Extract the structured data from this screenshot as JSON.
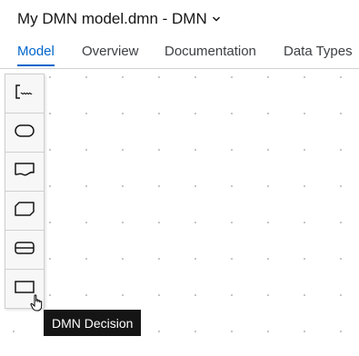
{
  "header": {
    "title": "My DMN model.dmn - DMN",
    "dropdown_icon": "chevron-down-icon"
  },
  "tabs": [
    {
      "label": "Model",
      "active": true
    },
    {
      "label": "Overview",
      "active": false
    },
    {
      "label": "Documentation",
      "active": false
    },
    {
      "label": "Data Types",
      "active": false
    }
  ],
  "palette": {
    "tools": [
      {
        "icon": "text-annotation-icon"
      },
      {
        "icon": "input-data-icon"
      },
      {
        "icon": "knowledge-source-icon"
      },
      {
        "icon": "business-knowledge-model-icon"
      },
      {
        "icon": "decision-service-icon"
      },
      {
        "icon": "decision-icon"
      }
    ]
  },
  "tooltip": {
    "text": "DMN Decision"
  },
  "colors": {
    "accent": "#0066cc",
    "tooltip_bg": "#151515",
    "palette_bg": "#f5f5f5"
  }
}
